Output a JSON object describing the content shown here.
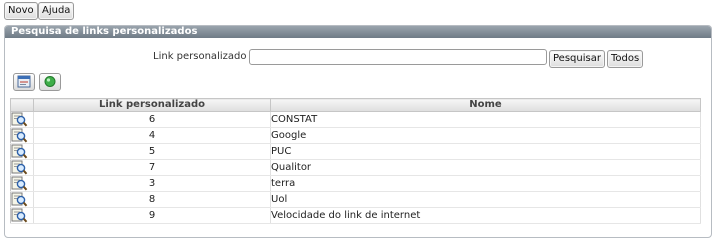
{
  "toolbar": {
    "novo_label": "Novo",
    "ajuda_label": "Ajuda"
  },
  "panel": {
    "title": "Pesquisa de links personalizados"
  },
  "search": {
    "label": "Link personalizado :",
    "value": "",
    "placeholder": "",
    "search_button": "Pesquisar",
    "all_button": "Todos"
  },
  "actions": {
    "new_icon": "new-record-icon",
    "refresh_icon": "refresh-icon"
  },
  "table": {
    "headers": [
      "",
      "Link personalizado",
      "Nome"
    ],
    "row_icon": "view-magnifier-icon",
    "rows": [
      {
        "link": "6",
        "nome": "CONSTAT"
      },
      {
        "link": "4",
        "nome": "Google"
      },
      {
        "link": "5",
        "nome": "PUC"
      },
      {
        "link": "7",
        "nome": "Qualitor"
      },
      {
        "link": "3",
        "nome": "terra"
      },
      {
        "link": "8",
        "nome": "Uol"
      },
      {
        "link": "9",
        "nome": "Velocidade do link de internet"
      }
    ]
  },
  "colors": {
    "header_bar": "#7d8892",
    "panel_border": "#b7bcc2",
    "accent_green": "#2e9b3a"
  }
}
